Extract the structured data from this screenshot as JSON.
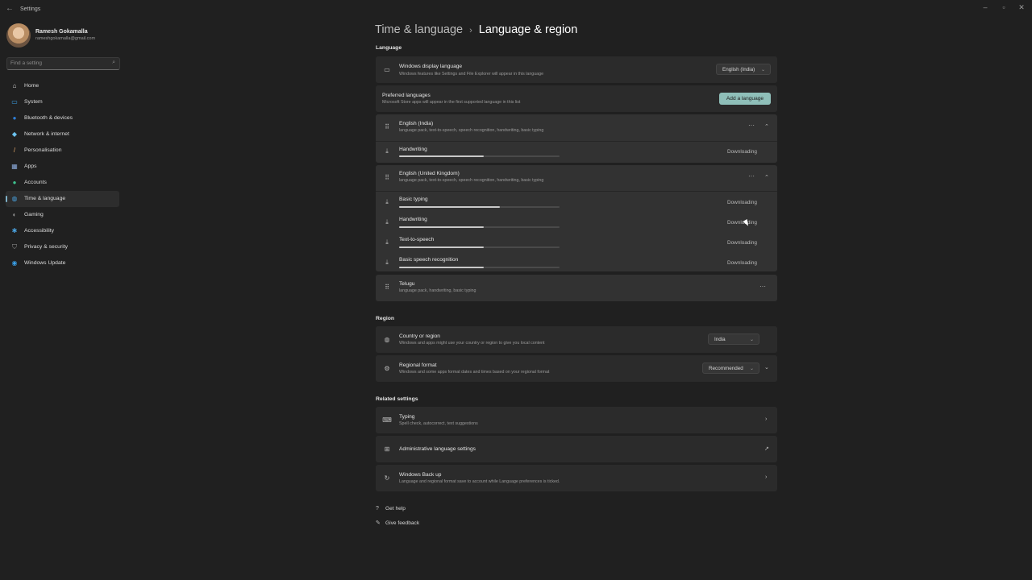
{
  "window": {
    "title": "Settings",
    "back_icon": "back-arrow-icon",
    "controls": [
      "minimize-icon",
      "maximize-icon",
      "close-icon"
    ]
  },
  "profile": {
    "name": "Ramesh Gokamalla",
    "email": "rameshgokamalla@gmail.com"
  },
  "search": {
    "placeholder": "Find a setting",
    "value": ""
  },
  "sidebar": {
    "items": [
      {
        "label": "Home",
        "icon": "home-icon",
        "color": "#d9d9d9",
        "active": false
      },
      {
        "label": "System",
        "icon": "system-icon",
        "color": "#3aa0e8",
        "active": false
      },
      {
        "label": "Bluetooth & devices",
        "icon": "bluetooth-icon",
        "color": "#2f7fd8",
        "active": false
      },
      {
        "label": "Network & internet",
        "icon": "wifi-icon",
        "color": "#6cc3f0",
        "active": false
      },
      {
        "label": "Personalisation",
        "icon": "brush-icon",
        "color": "#e6a96b",
        "active": false
      },
      {
        "label": "Apps",
        "icon": "apps-icon",
        "color": "#8aa8d8",
        "active": false
      },
      {
        "label": "Accounts",
        "icon": "accounts-icon",
        "color": "#3ec28f",
        "active": false
      },
      {
        "label": "Time & language",
        "icon": "globe-clock-icon",
        "color": "#4aa3e0",
        "active": true
      },
      {
        "label": "Gaming",
        "icon": "gaming-icon",
        "color": "#9a9a9a",
        "active": false
      },
      {
        "label": "Accessibility",
        "icon": "accessibility-icon",
        "color": "#4aa3e0",
        "active": false
      },
      {
        "label": "Privacy & security",
        "icon": "shield-icon",
        "color": "#9a9a9a",
        "active": false
      },
      {
        "label": "Windows Update",
        "icon": "update-icon",
        "color": "#3aa0e8",
        "active": false
      }
    ]
  },
  "breadcrumb": {
    "parent": "Time & language",
    "separator": "›",
    "current": "Language & region"
  },
  "language": {
    "heading": "Language",
    "display": {
      "title": "Windows display language",
      "subtitle": "Windows features like Settings and File Explorer will appear in this language",
      "value": "English (India)"
    },
    "preferred": {
      "title": "Preferred languages",
      "subtitle": "Microsoft Store apps will appear in the first supported language in this list",
      "add_button": "Add a language"
    },
    "languages": [
      {
        "name": "English (India)",
        "features": "language pack, text-to-speech, speech recognition, handwriting, basic typing",
        "downloads": [
          {
            "label": "Handwriting",
            "status": "Downloading",
            "progress": 0.53
          }
        ]
      },
      {
        "name": "English (United Kingdom)",
        "features": "language pack, text-to-speech, speech recognition, handwriting, basic typing",
        "downloads": [
          {
            "label": "Basic typing",
            "status": "Downloading",
            "progress": 0.63
          },
          {
            "label": "Handwriting",
            "status": "Downloading",
            "progress": 0.53
          },
          {
            "label": "Text-to-speech",
            "status": "Downloading",
            "progress": 0.53
          },
          {
            "label": "Basic speech recognition",
            "status": "Downloading",
            "progress": 0.53
          }
        ]
      },
      {
        "name": "Telugu",
        "features": "language pack, handwriting, basic typing",
        "downloads": []
      }
    ]
  },
  "region": {
    "heading": "Region",
    "country": {
      "title": "Country or region",
      "subtitle": "Windows and apps might use your country or region to give you local content",
      "value": "India"
    },
    "format": {
      "title": "Regional format",
      "subtitle": "Windows and some apps format dates and times based on your regional format",
      "value": "Recommended"
    }
  },
  "related": {
    "heading": "Related settings",
    "items": [
      {
        "title": "Typing",
        "subtitle": "Spell check, autocorrect, text suggestions",
        "icon": "keyboard-icon",
        "action": "chevron-right-icon"
      },
      {
        "title": "Administrative language settings",
        "subtitle": "",
        "icon": "admin-icon",
        "action": "external-link-icon"
      },
      {
        "title": "Windows Back up",
        "subtitle": "Language and regional format save to account while Language preferences is ticked.",
        "icon": "backup-icon",
        "action": "chevron-right-icon"
      }
    ]
  },
  "help": {
    "get_help": "Get help",
    "give_feedback": "Give feedback"
  },
  "colors": {
    "background": "#202020",
    "card": "#2b2b2b",
    "accent": "#8fbfb9"
  }
}
